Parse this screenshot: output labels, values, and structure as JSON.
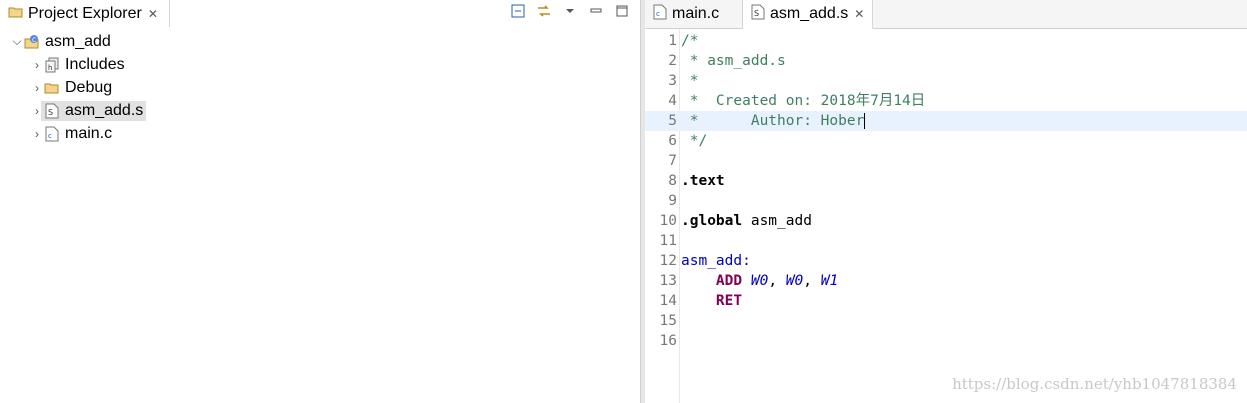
{
  "explorer": {
    "tab_label": "Project Explorer",
    "tree": {
      "project": "asm_add",
      "children": [
        {
          "label": "Includes"
        },
        {
          "label": "Debug"
        },
        {
          "label": "asm_add.s"
        },
        {
          "label": "main.c"
        }
      ]
    }
  },
  "editor": {
    "tabs": [
      {
        "label": "main.c"
      },
      {
        "label": "asm_add.s"
      }
    ],
    "lines": [
      {
        "n": "1",
        "text": "/*"
      },
      {
        "n": "2",
        "text": " * asm_add.s"
      },
      {
        "n": "3",
        "text": " *"
      },
      {
        "n": "4",
        "text": " *  Created on: 2018年7月14日"
      },
      {
        "n": "5",
        "text": " *      Author: Hober"
      },
      {
        "n": "6",
        "text": " */"
      },
      {
        "n": "7",
        "text": ""
      },
      {
        "n": "8",
        "directive": ".text"
      },
      {
        "n": "9",
        "text": ""
      },
      {
        "n": "10",
        "directive": ".global",
        "arg": " asm_add"
      },
      {
        "n": "11",
        "text": ""
      },
      {
        "n": "12",
        "label": "asm_add:"
      },
      {
        "n": "13",
        "indent": "    ",
        "instr": "ADD",
        "ops": [
          " W0",
          ", ",
          "W0",
          ", ",
          "W1"
        ]
      },
      {
        "n": "14",
        "indent": "    ",
        "instr": "RET"
      },
      {
        "n": "15",
        "text": ""
      },
      {
        "n": "16",
        "text": ""
      }
    ]
  },
  "watermark": "https://blog.csdn.net/yhb1047818384"
}
